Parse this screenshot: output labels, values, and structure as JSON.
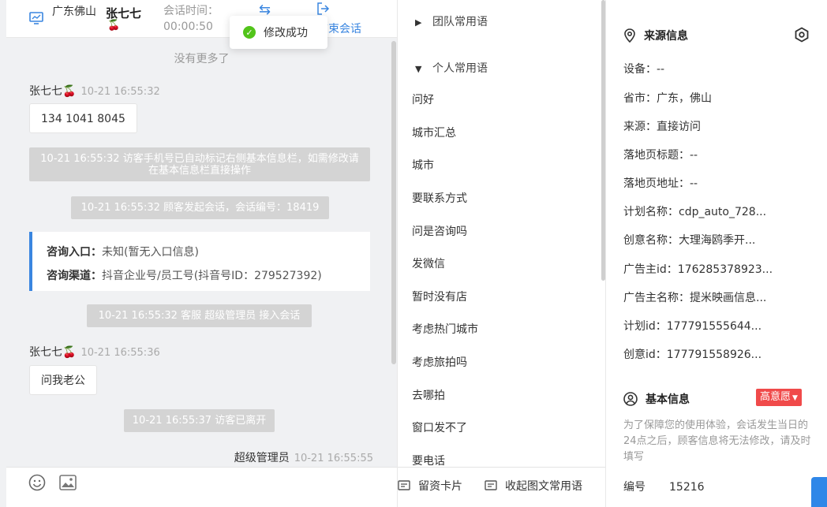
{
  "header": {
    "location": "广东佛山",
    "visitor_name": "张七七",
    "session_time_label": "会话时间：",
    "session_time": "00:00:50",
    "end_session": "结束会话"
  },
  "toast": {
    "text": "修改成功"
  },
  "messages": {
    "no_more": "没有更多了",
    "visitor_name": "张七七🍒",
    "msg1_time": "10-21 16:55:32",
    "msg1_text": "134 1041 8045",
    "sys1": "10-21 16:55:32 访客手机号已自动标记右侧基本信息栏，如需修改请在基本信息栏直接操作",
    "sys2": "10-21 16:55:32 顾客发起会话，会话编号：18419",
    "entry_label": "咨询入口：",
    "entry_value": "未知(暂无入口信息)",
    "channel_label": "咨询渠道：",
    "channel_value": "抖音企业号/员工号(抖音号ID：279527392)",
    "sys3": "10-21 16:55:32 客服 超级管理员 接入会话",
    "msg2_time": "10-21 16:55:36",
    "msg2_text": "问我老公",
    "sys4": "10-21 16:55:37 访客已离开",
    "self_name": "超级管理员",
    "self_time": "10-21 16:55:55"
  },
  "phrases": {
    "team_group": "团队常用语",
    "personal_group": "个人常用语",
    "items": [
      "问好",
      "城市汇总",
      "城市",
      "要联系方式",
      "问是咨询吗",
      "发微信",
      "暂时没有店",
      "考虑热门城市",
      "考虑旅拍吗",
      "去哪拍",
      "窗口发不了",
      "要电话"
    ],
    "card_button": "留资卡片",
    "collect_button": "收起图文常用语"
  },
  "source_info": {
    "title": "来源信息",
    "device": "设备：--",
    "province": "省市：广东，佛山",
    "source": "来源：直接访问",
    "landing_title": "落地页标题：--",
    "landing_url": "落地页地址：--",
    "plan_name": "计划名称：cdp_auto_728...",
    "creative_name": "创意名称：大理海鸥季开...",
    "advertiser_id": "广告主id：176285378923...",
    "advertiser_name": "广告主名称：提米映画信息...",
    "plan_id": "计划id：177791555644...",
    "creative_id": "创意id：177791558926..."
  },
  "basic_info": {
    "title": "基本信息",
    "badge": "高意愿",
    "hint": "为了保障您的使用体验，会话发生当日的24点之后，顾客信息将无法修改，请及时填写",
    "number_label": "编号",
    "number_value": "15216"
  }
}
